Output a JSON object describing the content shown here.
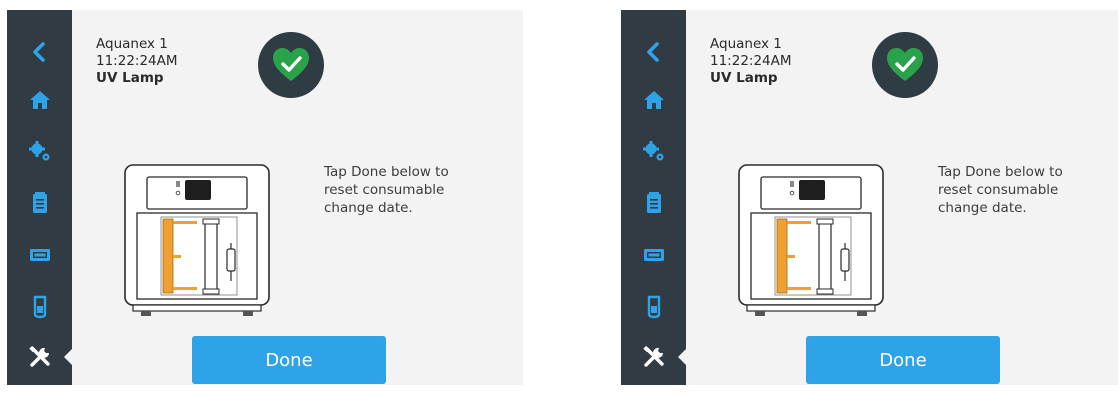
{
  "screens": [
    {
      "device_name": "Aquanex 1",
      "clock": "11:22:24AM",
      "page_title": "UV Lamp",
      "instruction": "Tap Done below to reset consumable change date.",
      "done_label": "Done"
    },
    {
      "device_name": "Aquanex 1",
      "clock": "11:22:24AM",
      "page_title": "UV Lamp",
      "instruction": "Tap Done below to reset consumable change date.",
      "done_label": "Done"
    }
  ],
  "sidebar_icons": [
    "back-chevron-icon",
    "home-icon",
    "settings-gears-icon",
    "clipboard-icon",
    "consumable-cartridge-icon",
    "beaker-icon",
    "tools-icon"
  ],
  "status_icon": "heart-check-icon",
  "colors": {
    "sidebar": "#303b44",
    "icon_blue": "#2fa3e8",
    "status_green": "#2aa24a",
    "badge_background": "#2f3c44",
    "highlight_orange": "#f0a030",
    "done_button": "#2fa3e8"
  }
}
